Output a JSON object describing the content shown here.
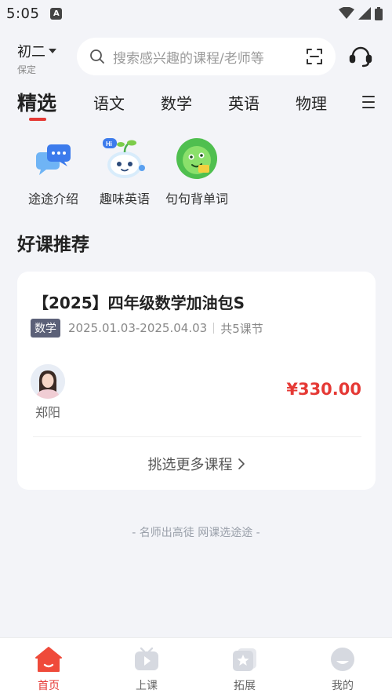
{
  "status_bar": {
    "time": "5:05",
    "notification_glyph": "A"
  },
  "header": {
    "grade": "初二",
    "city": "保定",
    "search_placeholder": "搜索感兴趣的课程/老师等"
  },
  "tabs": [
    {
      "label": "精选",
      "active": true
    },
    {
      "label": "语文",
      "active": false
    },
    {
      "label": "数学",
      "active": false
    },
    {
      "label": "英语",
      "active": false
    },
    {
      "label": "物理",
      "active": false
    }
  ],
  "shortcuts": [
    {
      "label": "途途介绍",
      "icon": "chat-bubbles-icon"
    },
    {
      "label": "趣味英语",
      "icon": "mascot-icon"
    },
    {
      "label": "句句背单词",
      "icon": "green-character-icon"
    }
  ],
  "section": {
    "title": "好课推荐"
  },
  "course": {
    "title": "【2025】四年级数学加油包S",
    "subject": "数学",
    "date_range": "2025.01.03-2025.04.03",
    "lessons": "共5课节",
    "teacher": "郑阳",
    "price": "¥330.00",
    "more_label": "挑选更多课程"
  },
  "slogan": "- 名师出高徒 网课选途途 -",
  "bottom_nav": [
    {
      "label": "首页",
      "icon": "home-icon",
      "active": true
    },
    {
      "label": "上课",
      "icon": "play-icon",
      "active": false
    },
    {
      "label": "拓展",
      "icon": "star-icon",
      "active": false
    },
    {
      "label": "我的",
      "icon": "profile-icon",
      "active": false
    }
  ],
  "colors": {
    "accent": "#e53935",
    "background": "#f3f4f8"
  }
}
